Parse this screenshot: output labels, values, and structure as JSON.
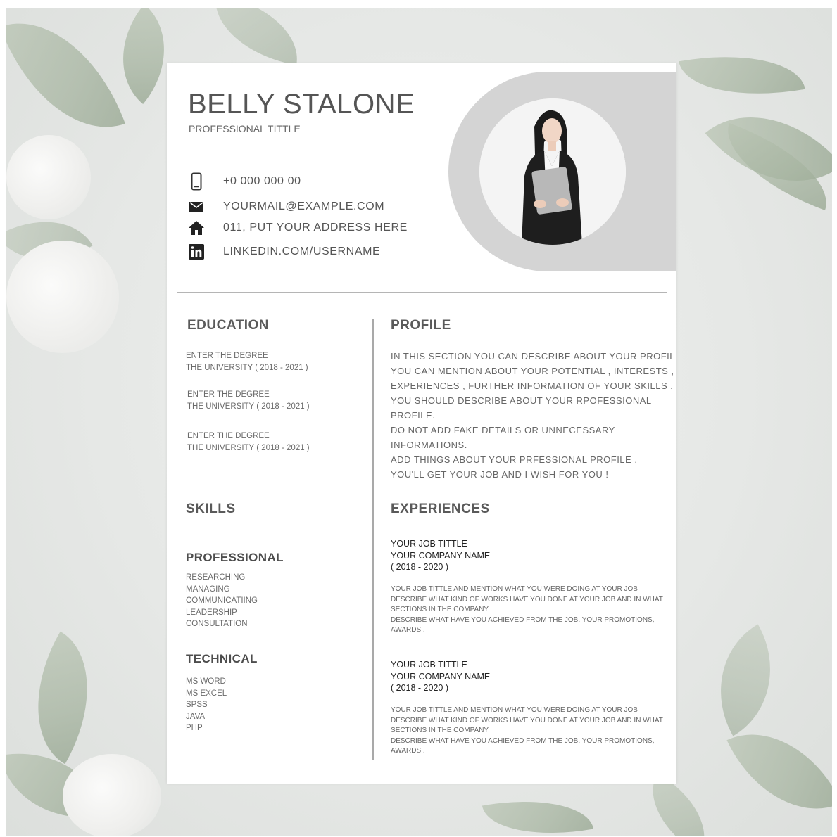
{
  "resume": {
    "name": "BELLY STALONE",
    "title": "PROFESSIONAL TITTLE",
    "contacts": [
      {
        "icon": "phone-icon",
        "text": "+0 000 000 00"
      },
      {
        "icon": "mail-icon",
        "text": "YOURMAIL@EXAMPLE.COM"
      },
      {
        "icon": "home-icon",
        "text": "011, PUT YOUR ADDRESS HERE"
      },
      {
        "icon": "linkedin-icon",
        "text": "LINKEDIN.COM/USERNAME"
      }
    ],
    "education": {
      "heading": "EDUCATION",
      "entries": [
        {
          "degree": "ENTER THE DEGREE",
          "university": "THE UNIVERSITY  ( 2018 - 2021 )"
        },
        {
          "degree": "ENTER THE DEGREE",
          "university": "THE UNIVERSITY  ( 2018 - 2021 )"
        },
        {
          "degree": "ENTER THE DEGREE",
          "university": "THE UNIVERSITY  ( 2018 - 2021 )"
        }
      ]
    },
    "skills": {
      "heading": "SKILLS",
      "professional_heading": "PROFESSIONAL",
      "professional": [
        "RESEARCHING",
        "MANAGING",
        "COMMUNICATIING",
        "LEADERSHIP",
        "CONSULTATION"
      ],
      "technical_heading": "TECHNICAL",
      "technical": [
        "MS WORD",
        "MS EXCEL",
        "SPSS",
        "JAVA",
        "PHP"
      ]
    },
    "profile": {
      "heading": "PROFILE",
      "lines": [
        "IN THIS SECTION YOU CAN DESCRIBE ABOUT YOUR PROFILE,",
        "YOU CAN MENTION ABOUT YOUR POTENTIAL , INTERESTS ,",
        "EXPERIENCES , FURTHER INFORMATION OF YOUR SKILLS .",
        "YOU SHOULD DESCRIBE ABOUT YOUR RPOFESSIONAL",
        "PROFILE.",
        "DO NOT ADD FAKE DETAILS OR UNNECESSARY",
        "INFORMATIONS.",
        "ADD THINGS ABOUT YOUR PRFESSIONAL PROFILE ,",
        "YOU'LL GET YOUR JOB AND I WISH FOR YOU !"
      ]
    },
    "experiences": {
      "heading": "EXPERIENCES",
      "jobs": [
        {
          "job_title": "YOUR JOB TITTLE",
          "company": "YOUR COMPANY NAME",
          "years": "( 2018 - 2020 )",
          "desc": [
            "YOUR JOB TITTLE AND MENTION WHAT YOU WERE DOING AT YOUR JOB",
            "DESCRIBE WHAT KIND OF WORKS HAVE YOU DONE AT YOUR JOB AND IN WHAT",
            "SECTIONS IN THE COMPANY",
            "DESCRIBE WHAT HAVE YOU ACHIEVED FROM THE JOB, YOUR PROMOTIONS,",
            "AWARDS.."
          ]
        },
        {
          "job_title": "YOUR JOB TITTLE",
          "company": "YOUR COMPANY NAME",
          "years": "( 2018 - 2020 )",
          "desc": [
            "YOUR JOB TITTLE AND MENTION WHAT YOU WERE DOING AT YOUR JOB",
            "DESCRIBE WHAT KIND OF WORKS HAVE YOU DONE AT YOUR JOB AND IN WHAT",
            "SECTIONS IN THE COMPANY",
            "DESCRIBE WHAT HAVE YOU ACHIEVED FROM THE JOB, YOUR PROMOTIONS,",
            "AWARDS.."
          ]
        }
      ]
    }
  },
  "colors": {
    "accent_gray": "#d4d4d4",
    "heading": "#5a5a5a",
    "text": "#666666"
  }
}
